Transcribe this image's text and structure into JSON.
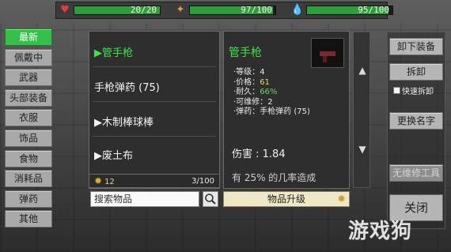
{
  "status": {
    "health": {
      "icon": "heart-icon",
      "text": "20/20",
      "fill": 1.0,
      "color": "#e03a3a"
    },
    "food": {
      "icon": "food-icon",
      "text": "97/100",
      "fill": 0.97,
      "color": "#d8a040"
    },
    "water": {
      "icon": "water-drop-icon",
      "text": "95/100",
      "fill": 0.95,
      "color": "#3a9be0"
    }
  },
  "categories": [
    "最新",
    "佩戴中",
    "武器",
    "头部装备",
    "衣服",
    "饰品",
    "食物",
    "消耗品",
    "弹药",
    "其他"
  ],
  "active_category": 0,
  "items": [
    {
      "label": "▶管手枪",
      "selected": true
    },
    {
      "label": "手枪弹药 (75)",
      "selected": false
    },
    {
      "label": "▶木制棒球棒",
      "selected": false
    },
    {
      "label": "▶废土布",
      "selected": false
    }
  ],
  "list_footer": {
    "gear_count": "12",
    "capacity": "3/100"
  },
  "search": {
    "placeholder": "搜索物品"
  },
  "detail": {
    "name": "管手枪",
    "attributes": [
      {
        "label": "·等级：",
        "value": "4",
        "color": "white"
      },
      {
        "label": "·价格：",
        "value": "61",
        "color": "yellow"
      },
      {
        "label": "·耐久：",
        "value": "66%",
        "color": "green"
      },
      {
        "label": "·可维修：",
        "value": "2",
        "color": "white"
      },
      {
        "label": "·弹药：",
        "value": "手枪弹药 (75)",
        "color": "white"
      }
    ],
    "damage": "伤害 : 1.84",
    "description": "有 25% 的几率造成"
  },
  "upgrade_label": "物品升级",
  "right_buttons": {
    "unequip": "卸下装备",
    "dismantle": "拆卸",
    "quick_dismantle": "快速拆卸",
    "rename": "更换名字",
    "no_repair_tool": "无维修工具",
    "close": "关闭"
  },
  "watermark": "游戏狗"
}
